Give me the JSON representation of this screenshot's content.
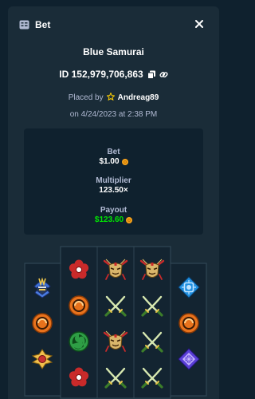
{
  "modal": {
    "title": "Bet",
    "game_name": "Blue Samurai",
    "bet_id": "ID 152,979,706,863",
    "placed_by_prefix": "Placed by",
    "username": "Andreag89",
    "date": "on 4/24/2023 at 2:38 PM"
  },
  "summary": {
    "bet_label": "Bet",
    "bet_value": "$1.00",
    "multiplier_label": "Multiplier",
    "multiplier_value": "123.50×",
    "payout_label": "Payout",
    "payout_value": "$123.60"
  },
  "board": {
    "columns": [
      [
        "samurai-helmet-icon",
        "orange-orb-icon",
        "gold-flower-icon"
      ],
      [
        "red-flower-icon",
        "orange-orb-icon",
        "green-swirl-icon",
        "red-flower-icon"
      ],
      [
        "samurai-mask-icon",
        "crossed-swords-icon",
        "samurai-mask-icon",
        "crossed-swords-icon"
      ],
      [
        "samurai-mask-icon",
        "crossed-swords-icon",
        "crossed-swords-icon",
        "crossed-swords-icon"
      ],
      [
        "blue-crest-icon",
        "orange-orb-icon",
        "purple-diamond-icon"
      ]
    ]
  },
  "colors": {
    "background": "#0f212e",
    "panel": "#1a2c38",
    "muted_text": "#b1bad3",
    "payout_green": "#00e701",
    "coin_orange": "#f7a21b"
  }
}
